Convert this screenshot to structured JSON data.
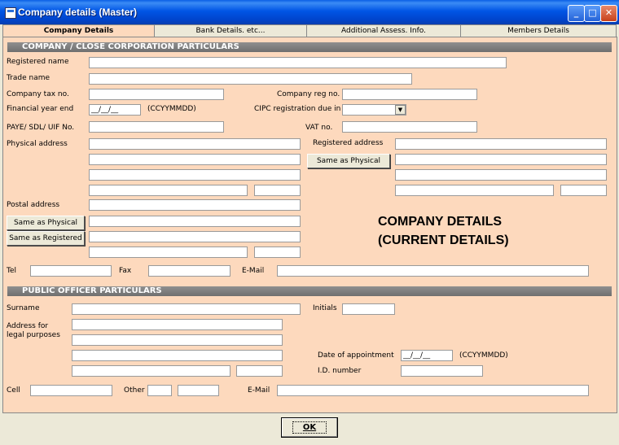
{
  "window": {
    "title": "Company details (Master)",
    "min": "_",
    "max": "□",
    "close": "✕"
  },
  "tabs": [
    "Company Details",
    "Bank Details. etc...",
    "Additional Assess. Info.",
    "Members Details"
  ],
  "company": {
    "section_title": "COMPANY / CLOSE CORPORATION PARTICULARS",
    "registered_name": "Registered name",
    "trade_name": "Trade name",
    "tax_no": "Company tax no.",
    "reg_no": "Company reg no.",
    "fy_end": "Financial year end",
    "date_mask": "__/__/__",
    "date_format": "(CCYYMMDD)",
    "cipc_due": "CIPC registration due in",
    "paye": "PAYE/ SDL/ UIF No.",
    "vat": "VAT no.",
    "physical_address": "Physical address",
    "registered_address": "Registered address",
    "same_as_physical": "Same as Physical",
    "postal_address": "Postal address",
    "postal_same_as_physical": "Same as Physical",
    "postal_same_as_registered": "Same as Registered",
    "banner_line1": "COMPANY DETAILS",
    "banner_line2": "(CURRENT DETAILS)",
    "tel": "Tel",
    "fax": "Fax",
    "email": "E-Mail"
  },
  "officer": {
    "section_title": "PUBLIC OFFICER PARTICULARS",
    "surname": "Surname",
    "initials": "Initials",
    "address_line1": "Address for",
    "address_line2": "legal purposes",
    "date_of_appointment": "Date of appointment",
    "date_mask": "__/__/__",
    "date_format": "(CCYYMMDD)",
    "id_number": "I.D. number",
    "cell": "Cell",
    "other": "Other",
    "email": "E-Mail"
  },
  "ok_button": "OK",
  "colors": {
    "panel_bg": "#fdd9bd",
    "section_bg": "#7f7f7f",
    "titlebar": "#0055e5"
  }
}
